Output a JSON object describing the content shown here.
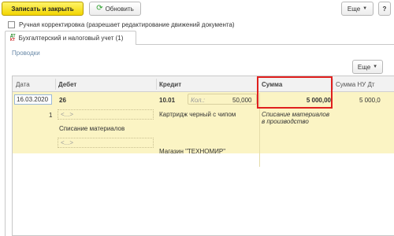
{
  "toolbar": {
    "save_close_label": "Записать и закрыть",
    "refresh_label": "Обновить",
    "more_label": "Еще",
    "help_label": "?"
  },
  "manual_correction": {
    "label": "Ручная корректировка (разрешает редактирование движений документа)",
    "checked": false
  },
  "tab": {
    "icon_top": "ДТ",
    "icon_bottom": "КТ",
    "label": "Бухгалтерский и налоговый учет (1)"
  },
  "section": {
    "title": "Проводки",
    "more_label": "Еще"
  },
  "grid": {
    "columns": [
      "Дата",
      "Дебет",
      "Кредит",
      "Сумма",
      "Сумма НУ Дт"
    ],
    "row": {
      "date": "16.03.2020",
      "line_no": "1",
      "debit_account": "26",
      "debit_placeholder": "<...>",
      "debit_subconto": "Списание материалов",
      "debit_placeholder2": "<...>",
      "credit_account": "10.01",
      "qty_label": "Кол.:",
      "qty_value": "50,000",
      "credit_subconto1": "Картридж черный с чипом",
      "credit_subconto2": "Магазин \"ТЕХНОМИР\"",
      "sum": "5 000,00",
      "content": "Списание материалов в производство",
      "sum_nu_dt": "5 000,0"
    }
  },
  "colors": {
    "primary_button": "#f2d500",
    "selected_row": "#fbf4c4",
    "highlight": "#e0201e",
    "section_title": "#6a8aa8"
  }
}
